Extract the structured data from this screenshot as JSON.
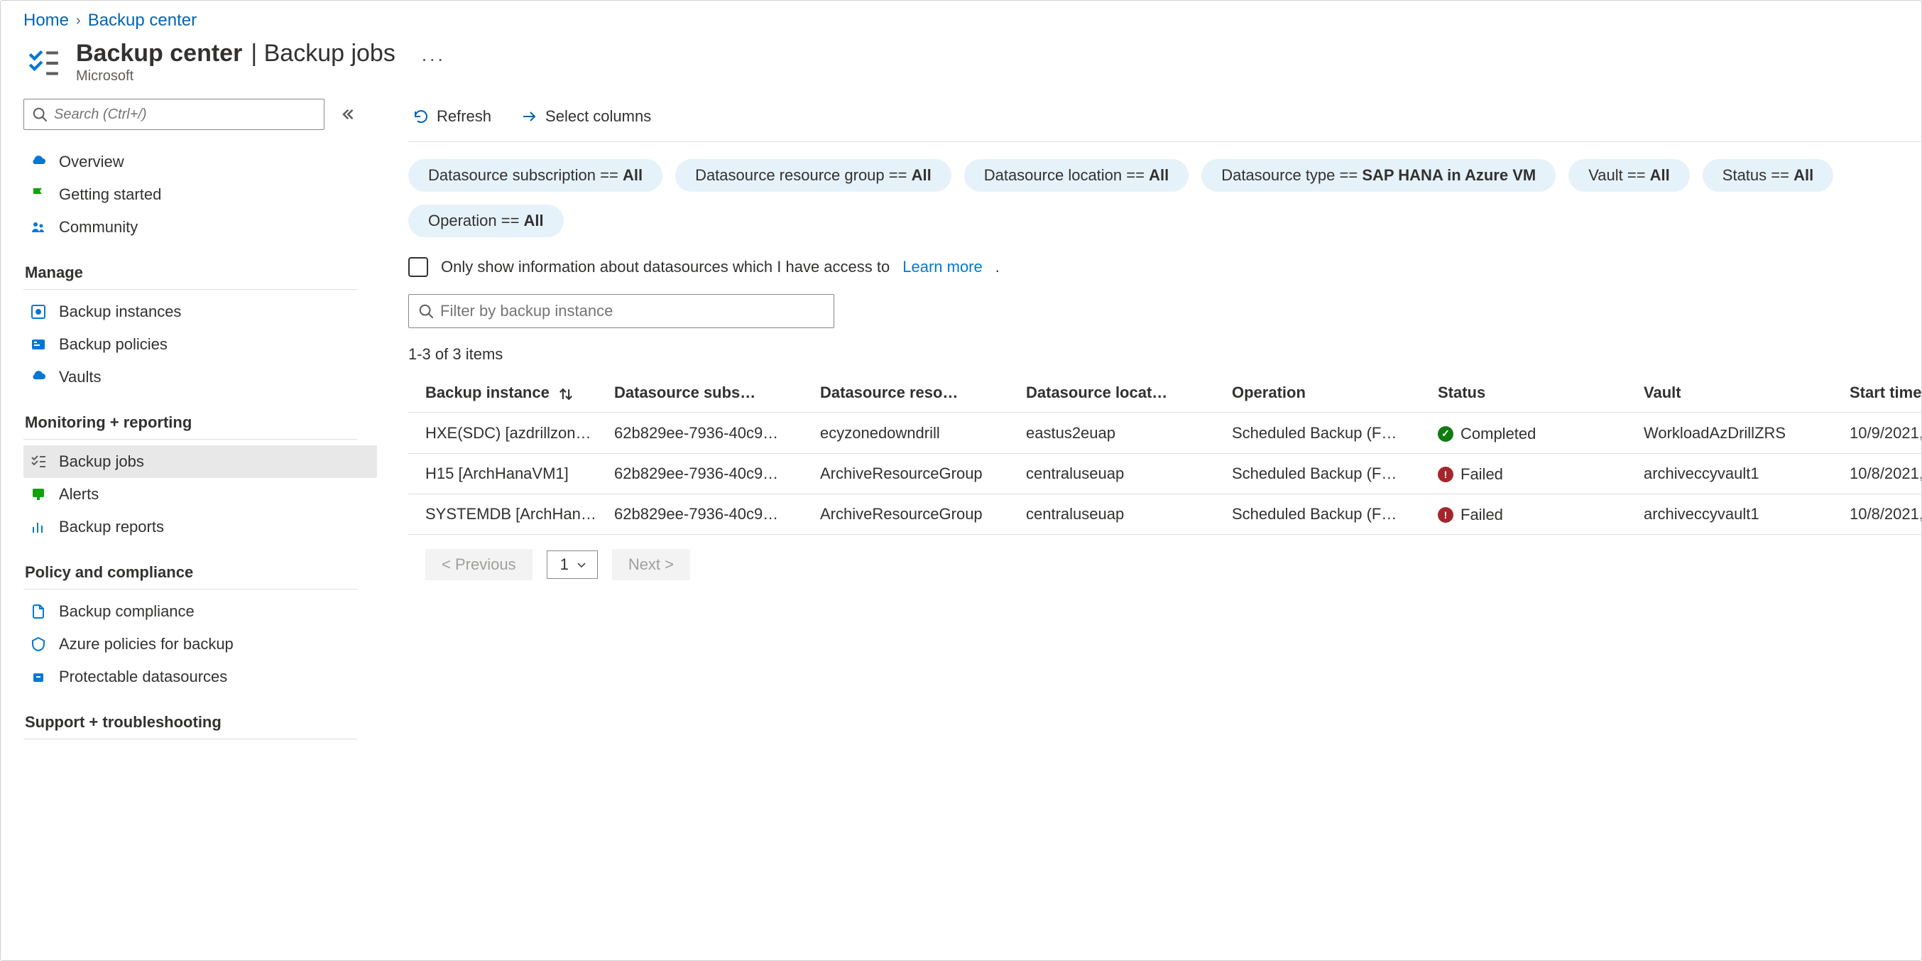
{
  "breadcrumbs": {
    "home": "Home",
    "backup_center": "Backup center"
  },
  "header": {
    "title_main": "Backup center",
    "title_suffix": "Backup jobs",
    "subtitle": "Microsoft",
    "more_label": "···"
  },
  "sidebar": {
    "search_placeholder": "Search (Ctrl+/)",
    "quick": [
      {
        "label": "Overview",
        "icon": "cloud"
      },
      {
        "label": "Getting started",
        "icon": "flag"
      },
      {
        "label": "Community",
        "icon": "people"
      }
    ],
    "sections": [
      {
        "heading": "Manage",
        "items": [
          {
            "label": "Backup instances",
            "icon": "instances"
          },
          {
            "label": "Backup policies",
            "icon": "policies"
          },
          {
            "label": "Vaults",
            "icon": "vault"
          }
        ]
      },
      {
        "heading": "Monitoring + reporting",
        "items": [
          {
            "label": "Backup jobs",
            "icon": "jobs",
            "active": true
          },
          {
            "label": "Alerts",
            "icon": "alerts"
          },
          {
            "label": "Backup reports",
            "icon": "reports"
          }
        ]
      },
      {
        "heading": "Policy and compliance",
        "items": [
          {
            "label": "Backup compliance",
            "icon": "compliance"
          },
          {
            "label": "Azure policies for backup",
            "icon": "azpolicy"
          },
          {
            "label": "Protectable datasources",
            "icon": "protectable"
          }
        ]
      },
      {
        "heading": "Support + troubleshooting",
        "items": []
      }
    ]
  },
  "toolbar": {
    "refresh": "Refresh",
    "select_columns": "Select columns"
  },
  "filters": [
    {
      "label_prefix": "Datasource subscription == ",
      "value": "All"
    },
    {
      "label_prefix": "Datasource resource group == ",
      "value": "All"
    },
    {
      "label_prefix": "Datasource location == ",
      "value": "All"
    },
    {
      "label_prefix": "Datasource type == ",
      "value": "SAP HANA in Azure VM"
    },
    {
      "label_prefix": "Vault == ",
      "value": "All"
    },
    {
      "label_prefix": "Status == ",
      "value": "All"
    },
    {
      "label_prefix": "Operation == ",
      "value": "All"
    }
  ],
  "access_row": {
    "text": "Only show information about datasources which I have access to",
    "learn_more": "Learn more"
  },
  "filter_input_placeholder": "Filter by backup instance",
  "count_line": "1-3 of 3 items",
  "table": {
    "columns": {
      "backup_instance": "Backup instance",
      "subscription": "Datasource subs…",
      "resource_group": "Datasource reso…",
      "location": "Datasource locat…",
      "operation": "Operation",
      "status": "Status",
      "vault": "Vault",
      "start_time": "Start time"
    },
    "rows": [
      {
        "backup_instance": "HXE(SDC) [azdrillzon…",
        "subscription": "62b829ee-7936-40c9…",
        "resource_group": "ecyzonedowndrill",
        "location": "eastus2euap",
        "operation": "Scheduled Backup (F…",
        "status": "Completed",
        "status_kind": "completed",
        "vault": "WorkloadAzDrillZRS",
        "start_time": "10/9/2021,"
      },
      {
        "backup_instance": "H15 [ArchHanaVM1]",
        "subscription": "62b829ee-7936-40c9…",
        "resource_group": "ArchiveResourceGroup",
        "location": "centraluseuap",
        "operation": "Scheduled Backup (F…",
        "status": "Failed",
        "status_kind": "failed",
        "vault": "archiveccyvault1",
        "start_time": "10/8/2021,"
      },
      {
        "backup_instance": "SYSTEMDB [ArchHan…",
        "subscription": "62b829ee-7936-40c9…",
        "resource_group": "ArchiveResourceGroup",
        "location": "centraluseuap",
        "operation": "Scheduled Backup (F…",
        "status": "Failed",
        "status_kind": "failed",
        "vault": "archiveccyvault1",
        "start_time": "10/8/2021,"
      }
    ]
  },
  "pager": {
    "prev": "<  Previous",
    "next": "Next  >",
    "page": "1"
  },
  "colors": {
    "link": "#0065b3",
    "completed": "#107c10",
    "failed": "#a4262c",
    "pill_bg": "#e6f2fa"
  }
}
